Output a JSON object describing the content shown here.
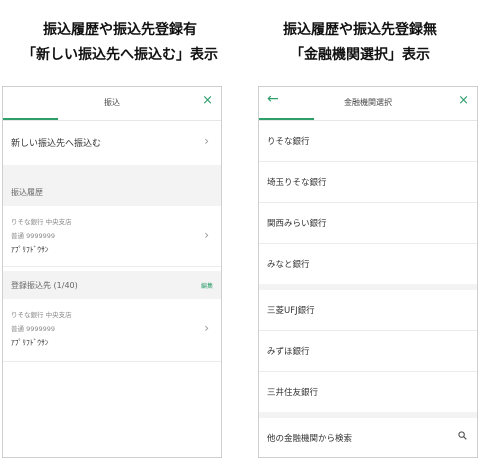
{
  "left": {
    "caption_line1": "振込履歴や振込先登録有",
    "caption_line2": "「新しい振込先へ振込む」表示",
    "header_title": "振込",
    "close_icon": "×",
    "new_transfer_label": "新しい振込先へ振込む",
    "history_section_label": "振込履歴",
    "history_items": [
      {
        "bank": "りそな銀行 中央支店",
        "account": "普通 9999999",
        "name": "ｱﾌﾟﾘﾌﾄﾞｳｻﾝ"
      }
    ],
    "registered_section_label": "登録振込先 (1/40)",
    "edit_label": "編集",
    "registered_items": [
      {
        "bank": "りそな銀行 中央支店",
        "account": "普通 9999999",
        "name": "ｱﾌﾟﾘﾌﾄﾞｳｻﾝ"
      }
    ]
  },
  "right": {
    "caption_line1": "振込履歴や振込先登録無",
    "caption_line2": "「金融機関選択」表示",
    "header_title": "金融機関選択",
    "back_icon": "←",
    "close_icon": "×",
    "banks_group1": [
      "りそな銀行",
      "埼玉りそな銀行",
      "関西みらい銀行",
      "みなと銀行"
    ],
    "banks_group2": [
      "三菱UFJ銀行",
      "みずほ銀行",
      "三井住友銀行"
    ],
    "search_label": "他の金融機関から検索"
  },
  "colors": {
    "accent": "#2e9e6b",
    "section_bg": "#f3f3f3"
  },
  "icons": [
    "close-icon",
    "back-arrow-icon",
    "chevron-right-icon",
    "search-icon"
  ]
}
